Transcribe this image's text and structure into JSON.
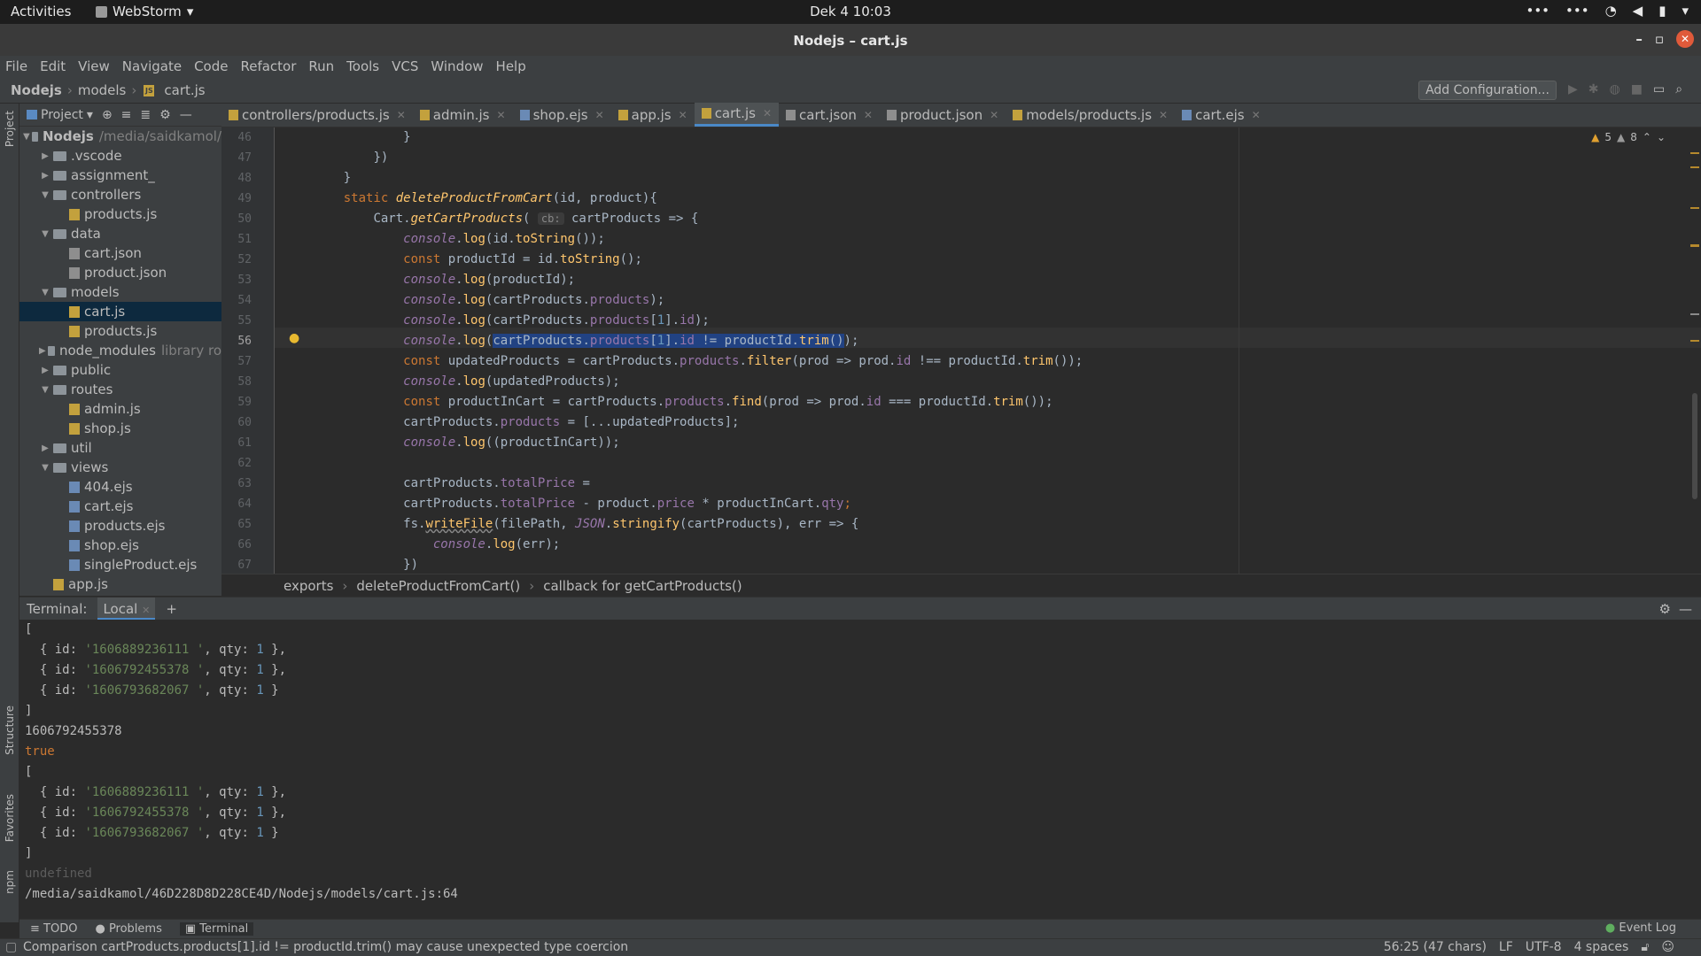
{
  "topbar": {
    "activities": "Activities",
    "app_name": "WebStorm",
    "clock": "Dek 4  10:03"
  },
  "window": {
    "title": "Nodejs – cart.js"
  },
  "menu": [
    "File",
    "Edit",
    "View",
    "Navigate",
    "Code",
    "Refactor",
    "Run",
    "Tools",
    "VCS",
    "Window",
    "Help"
  ],
  "navbar": {
    "crumbs": [
      "Nodejs",
      "models",
      "cart.js"
    ],
    "add_config": "Add Configuration..."
  },
  "project": {
    "header": "Project",
    "tree": [
      {
        "label": "Nodejs",
        "extra": "/media/saidkamol/",
        "depth": 0,
        "type": "folder",
        "open": true,
        "bold": true
      },
      {
        "label": ".vscode",
        "depth": 1,
        "type": "folder",
        "open": false
      },
      {
        "label": "assignment_",
        "depth": 1,
        "type": "folder",
        "open": false
      },
      {
        "label": "controllers",
        "depth": 1,
        "type": "folder",
        "open": true
      },
      {
        "label": "products.js",
        "depth": 2,
        "type": "js"
      },
      {
        "label": "data",
        "depth": 1,
        "type": "folder",
        "open": true
      },
      {
        "label": "cart.json",
        "depth": 2,
        "type": "json"
      },
      {
        "label": "product.json",
        "depth": 2,
        "type": "json"
      },
      {
        "label": "models",
        "depth": 1,
        "type": "folder",
        "open": true
      },
      {
        "label": "cart.js",
        "depth": 2,
        "type": "js",
        "selected": true
      },
      {
        "label": "products.js",
        "depth": 2,
        "type": "js"
      },
      {
        "label": "node_modules",
        "extra": "library ro",
        "depth": 1,
        "type": "folder",
        "open": false
      },
      {
        "label": "public",
        "depth": 1,
        "type": "folder",
        "open": false
      },
      {
        "label": "routes",
        "depth": 1,
        "type": "folder",
        "open": true
      },
      {
        "label": "admin.js",
        "depth": 2,
        "type": "js"
      },
      {
        "label": "shop.js",
        "depth": 2,
        "type": "js"
      },
      {
        "label": "util",
        "depth": 1,
        "type": "folder",
        "open": false
      },
      {
        "label": "views",
        "depth": 1,
        "type": "folder",
        "open": true
      },
      {
        "label": "404.ejs",
        "depth": 2,
        "type": "ejs"
      },
      {
        "label": "cart.ejs",
        "depth": 2,
        "type": "ejs"
      },
      {
        "label": "products.ejs",
        "depth": 2,
        "type": "ejs"
      },
      {
        "label": "shop.ejs",
        "depth": 2,
        "type": "ejs"
      },
      {
        "label": "singleProduct.ejs",
        "depth": 2,
        "type": "ejs"
      },
      {
        "label": "app.js",
        "depth": 1,
        "type": "js"
      }
    ]
  },
  "tabs": [
    {
      "label": "controllers/products.js",
      "type": "js"
    },
    {
      "label": "admin.js",
      "type": "js"
    },
    {
      "label": "shop.ejs",
      "type": "ejs"
    },
    {
      "label": "app.js",
      "type": "js"
    },
    {
      "label": "cart.js",
      "type": "js",
      "active": true
    },
    {
      "label": "cart.json",
      "type": "json"
    },
    {
      "label": "product.json",
      "type": "json"
    },
    {
      "label": "models/products.js",
      "type": "js"
    },
    {
      "label": "cart.ejs",
      "type": "ejs"
    }
  ],
  "editor": {
    "warnings": "5",
    "weak_warnings": "8",
    "line_numbers": [
      "46",
      "47",
      "48",
      "49",
      "50",
      "51",
      "52",
      "53",
      "54",
      "55",
      "56",
      "57",
      "58",
      "59",
      "60",
      "61",
      "62",
      "63",
      "64",
      "65",
      "66",
      "67"
    ],
    "current_line": "56",
    "param_hint": "cb:"
  },
  "code_breadcrumb": [
    "exports",
    "deleteProductFromCart()",
    "callback for getCartProducts()"
  ],
  "terminal": {
    "label": "Terminal:",
    "tab": "Local",
    "path": "/media/saidkamol/46D228D8D228CE4D/Nodejs/models/cart.js:64",
    "printed_id": "1606792455378",
    "bool": "true",
    "undef": "undefined",
    "ids": [
      "'1606889236111 '",
      "'1606792455378 '",
      "'1606793682067 '"
    ],
    "qty": "1"
  },
  "bottom_tabs": [
    "TODO",
    "Problems",
    "Terminal"
  ],
  "event_log": "Event Log",
  "status": {
    "message": "Comparison cartProducts.products[1].id != productId.trim() may cause unexpected type coercion",
    "position": "56:25 (47 chars)",
    "line_sep": "LF",
    "encoding": "UTF-8",
    "indent": "4 spaces"
  },
  "side_labels": {
    "project": "Project",
    "structure": "Structure",
    "favorites": "Favorites",
    "npm": "npm"
  }
}
